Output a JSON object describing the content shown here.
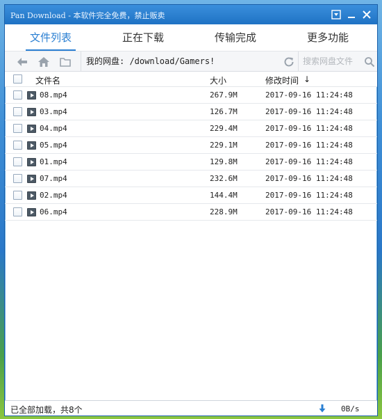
{
  "window": {
    "title": "Pan Download - 本软件完全免费，禁止贩卖"
  },
  "tabs": [
    {
      "label": "文件列表",
      "active": true
    },
    {
      "label": "正在下载",
      "active": false
    },
    {
      "label": "传输完成",
      "active": false
    },
    {
      "label": "更多功能",
      "active": false
    }
  ],
  "toolbar": {
    "path": "我的网盘: /download/Gamers!",
    "search_placeholder": "搜索网盘文件"
  },
  "list": {
    "columns": {
      "name": "文件名",
      "size": "大小",
      "modified": "修改时间",
      "sort_indicator": "↓"
    },
    "rows": [
      {
        "name": "08.mp4",
        "size": "267.9M",
        "modified": "2017-09-16 11:24:48"
      },
      {
        "name": "03.mp4",
        "size": "126.7M",
        "modified": "2017-09-16 11:24:48"
      },
      {
        "name": "04.mp4",
        "size": "229.4M",
        "modified": "2017-09-16 11:24:48"
      },
      {
        "name": "05.mp4",
        "size": "229.1M",
        "modified": "2017-09-16 11:24:48"
      },
      {
        "name": "01.mp4",
        "size": "129.8M",
        "modified": "2017-09-16 11:24:48"
      },
      {
        "name": "07.mp4",
        "size": "232.6M",
        "modified": "2017-09-16 11:24:48"
      },
      {
        "name": "02.mp4",
        "size": "144.4M",
        "modified": "2017-09-16 11:24:48"
      },
      {
        "name": "06.mp4",
        "size": "228.9M",
        "modified": "2017-09-16 11:24:48"
      }
    ]
  },
  "status": {
    "text": "已全部加载，共8个",
    "speed": "0B/s"
  },
  "colors": {
    "accent": "#2a7fd2",
    "titlebar": "#1f72c4"
  }
}
